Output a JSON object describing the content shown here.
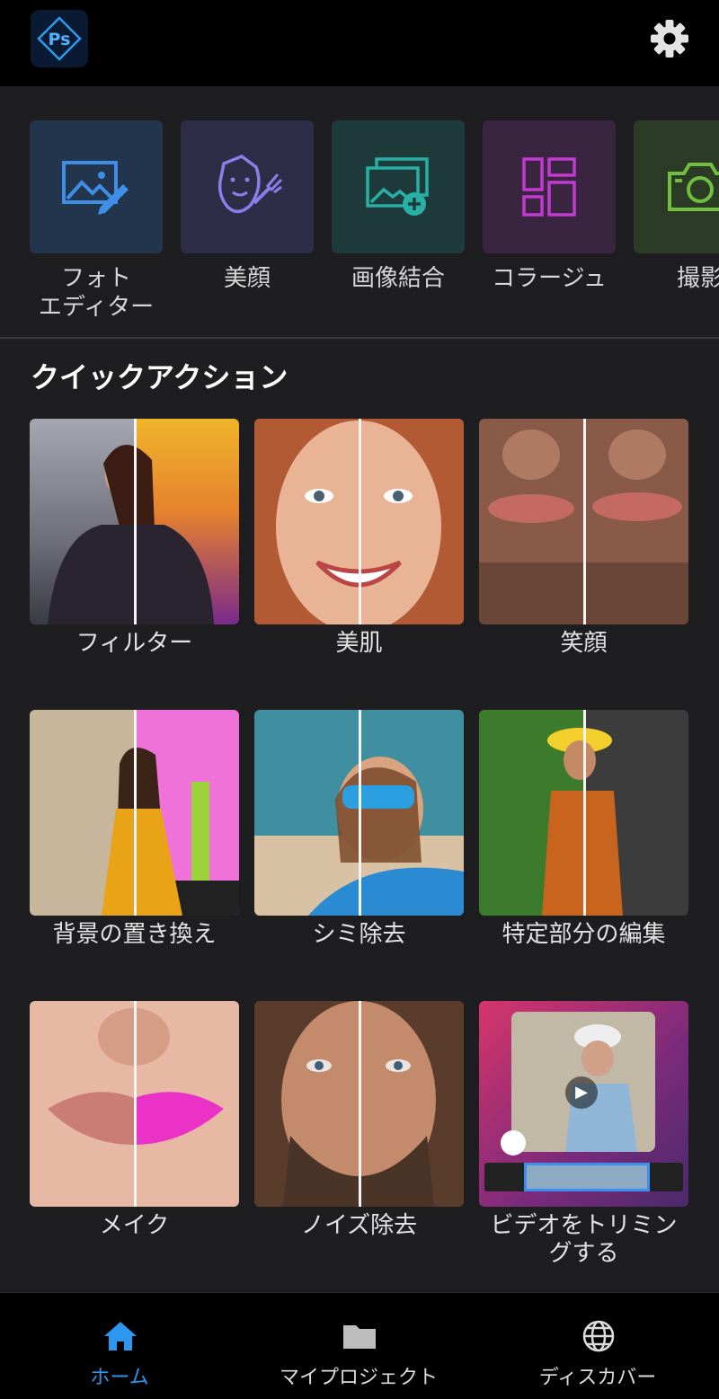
{
  "header": {
    "logo_text": "Ps",
    "settings_icon": "gear-icon"
  },
  "tools": [
    {
      "label": "フォト\nエディター",
      "icon": "photo-edit-icon",
      "bg": "#23344d",
      "fg": "#3f8fe8"
    },
    {
      "label": "美顔",
      "icon": "face-brush-icon",
      "bg": "#2f2c47",
      "fg": "#8c7ee8"
    },
    {
      "label": "画像結合",
      "icon": "photo-add-icon",
      "bg": "#1f3a3a",
      "fg": "#27b0a6"
    },
    {
      "label": "コラージュ",
      "icon": "collage-icon",
      "bg": "#3a2540",
      "fg": "#c23ad2"
    },
    {
      "label": "撮影",
      "icon": "camera-icon",
      "bg": "#2c3b25",
      "fg": "#6fbe3e"
    }
  ],
  "quick_actions": {
    "title": "クイックアクション",
    "items": [
      {
        "label": "フィルター"
      },
      {
        "label": "美肌"
      },
      {
        "label": "笑顔"
      },
      {
        "label": "背景の置き換え"
      },
      {
        "label": "シミ除去"
      },
      {
        "label": "特定部分の編集"
      },
      {
        "label": "メイク"
      },
      {
        "label": "ノイズ除去"
      },
      {
        "label": "ビデオをトリミン\nグする"
      }
    ]
  },
  "bottom_nav": [
    {
      "label": "ホーム",
      "icon": "home-icon",
      "active": true
    },
    {
      "label": "マイプロジェクト",
      "icon": "folder-icon",
      "active": false
    },
    {
      "label": "ディスカバー",
      "icon": "globe-icon",
      "active": false
    }
  ],
  "colors": {
    "accent": "#2d96ef",
    "background": "#1e1e20",
    "header": "#000000"
  }
}
